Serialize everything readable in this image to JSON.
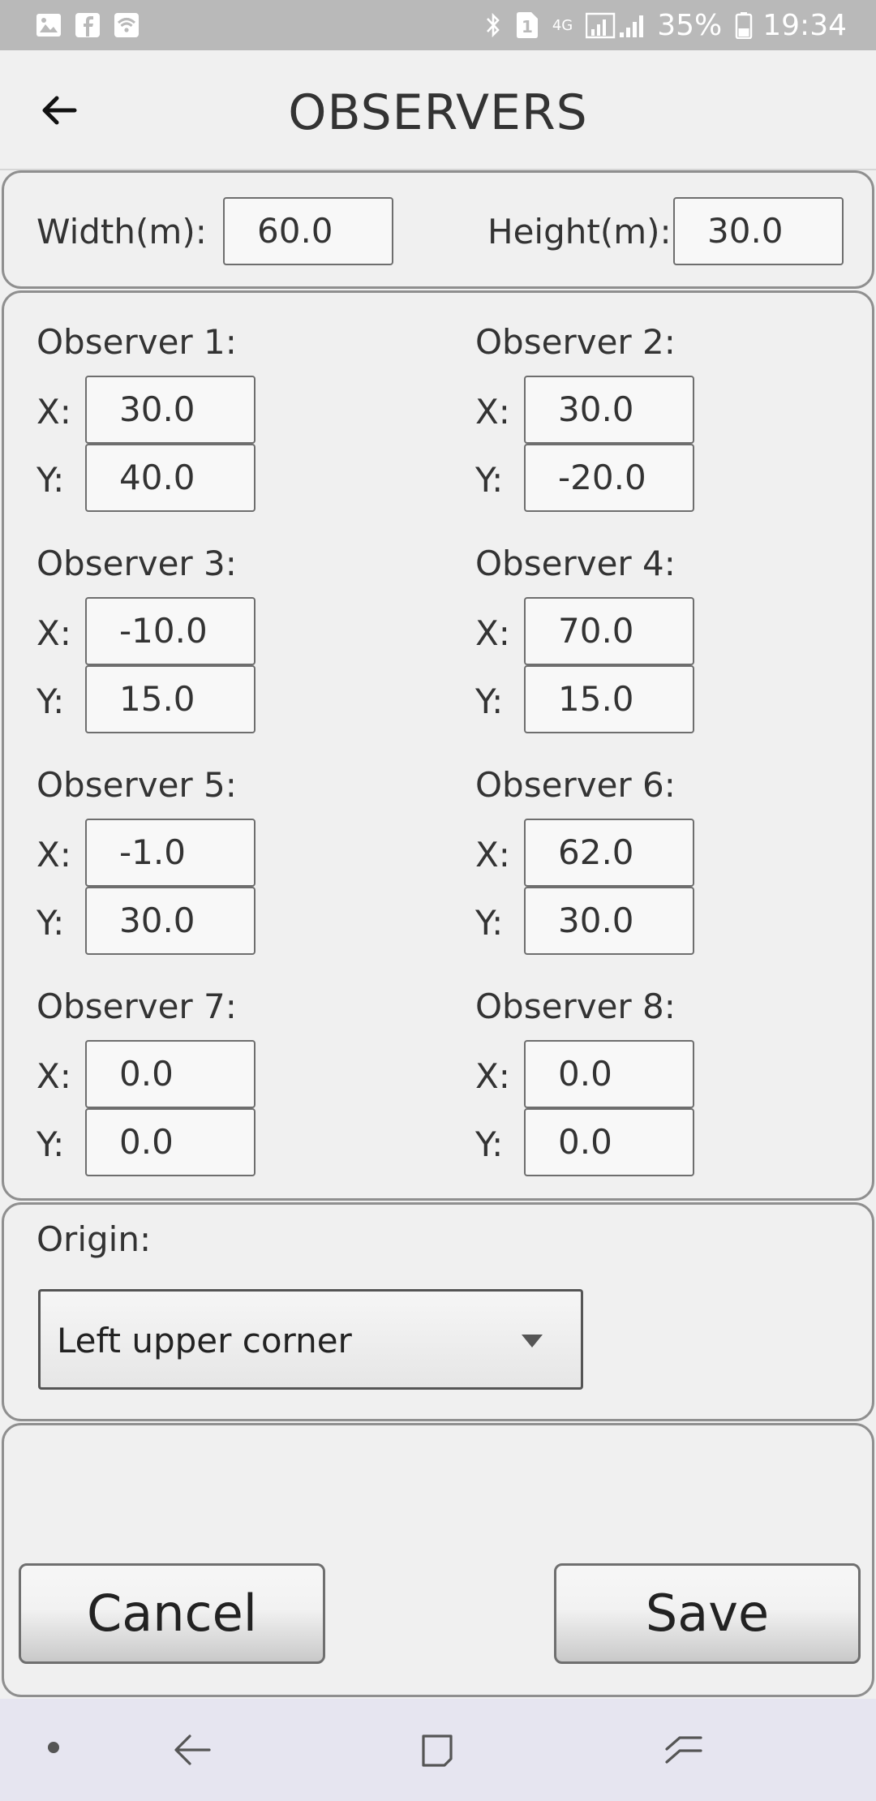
{
  "status_bar": {
    "battery": "35%",
    "time": "19:34",
    "sim_badge": "1",
    "network_type": "4G",
    "left_icons": [
      "image-icon",
      "facebook-icon",
      "wifi-icon"
    ],
    "right_icons": [
      "bluetooth-icon",
      "sim-icon",
      "signal-icon",
      "battery-icon"
    ]
  },
  "header": {
    "title": "OBSERVERS"
  },
  "dimensions": {
    "width_label": "Width(m):",
    "width_value": "60.0",
    "height_label": "Height(m):",
    "height_value": "30.0"
  },
  "observers": [
    {
      "label": "Observer 1:",
      "x_label": "X:",
      "y_label": "Y:",
      "x": "30.0",
      "y": "40.0"
    },
    {
      "label": "Observer 2:",
      "x_label": "X:",
      "y_label": "Y:",
      "x": "30.0",
      "y": "-20.0"
    },
    {
      "label": "Observer 3:",
      "x_label": "X:",
      "y_label": "Y:",
      "x": "-10.0",
      "y": "15.0"
    },
    {
      "label": "Observer 4:",
      "x_label": "X:",
      "y_label": "Y:",
      "x": "70.0",
      "y": "15.0"
    },
    {
      "label": "Observer 5:",
      "x_label": "X:",
      "y_label": "Y:",
      "x": "-1.0",
      "y": "30.0"
    },
    {
      "label": "Observer 6:",
      "x_label": "X:",
      "y_label": "Y:",
      "x": "62.0",
      "y": "30.0"
    },
    {
      "label": "Observer 7:",
      "x_label": "X:",
      "y_label": "Y:",
      "x": "0.0",
      "y": "0.0"
    },
    {
      "label": "Observer 8:",
      "x_label": "X:",
      "y_label": "Y:",
      "x": "0.0",
      "y": "0.0"
    }
  ],
  "origin": {
    "label": "Origin:",
    "selected": "Left upper corner"
  },
  "actions": {
    "cancel_label": "Cancel",
    "save_label": "Save"
  },
  "colors": {
    "status_bar": "#b9b9b9",
    "background": "#f0f0f0",
    "panel_border": "#8f8f8f",
    "nav_bar": "#e6e5f0"
  }
}
